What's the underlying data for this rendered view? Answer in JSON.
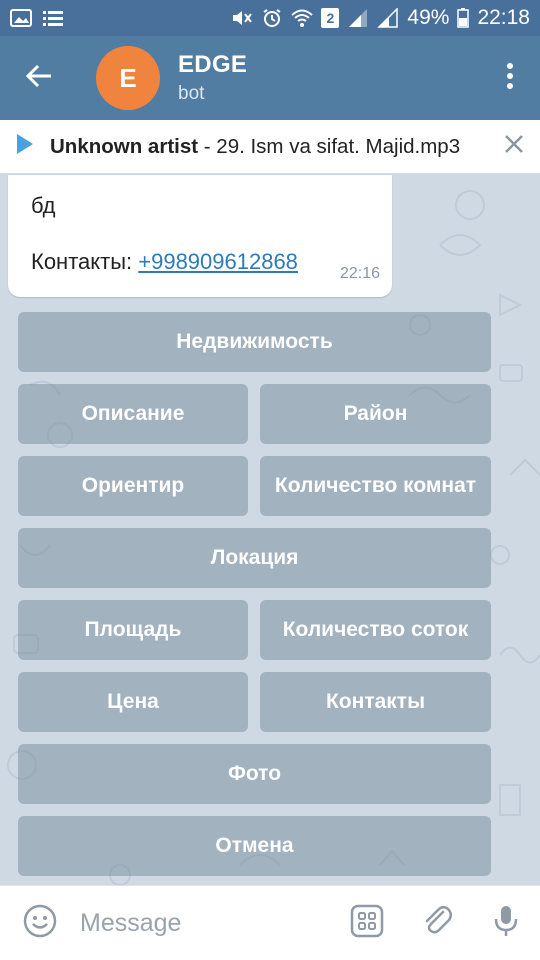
{
  "status_bar": {
    "battery_percent": "49%",
    "time": "22:18",
    "sim_badge": "2"
  },
  "header": {
    "avatar_letter": "E",
    "title": "EDGE",
    "subtitle": "bot",
    "avatar_color": "#f0843f"
  },
  "player": {
    "artist": "Unknown artist",
    "track": " - 29. Ism va sifat. Majid.mp3"
  },
  "message": {
    "line1": "бд",
    "contacts_label": "Контакты: ",
    "phone": "+998909612868",
    "time": "22:16"
  },
  "keyboard": {
    "buttons": [
      "Недвижимость",
      "Описание",
      "Район",
      "Ориентир",
      "Количество комнат",
      "Локация",
      "Площадь",
      "Количество соток",
      "Цена",
      "Контакты",
      "Фото",
      "Отмена"
    ]
  },
  "composer": {
    "placeholder": "Message"
  },
  "colors": {
    "header": "#527da3",
    "status_bar": "#49709b",
    "link": "#2f7bb7"
  }
}
